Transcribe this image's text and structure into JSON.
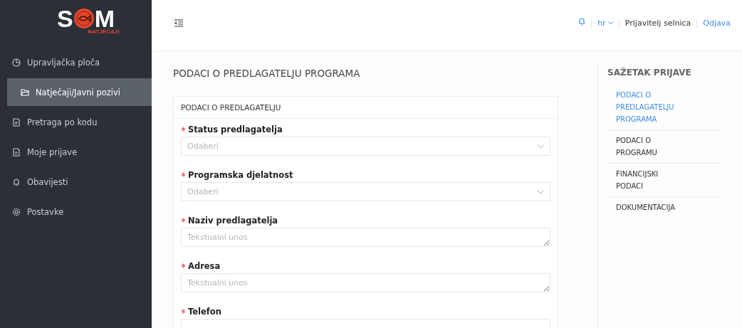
{
  "logo": {
    "left": "S",
    "right": "M",
    "subtitle": "NATJEČAJI"
  },
  "sidebar": {
    "items": [
      {
        "label": "Upravljačka ploča",
        "selected": false
      },
      {
        "label": "Natječaji/Javni pozivi",
        "selected": true
      },
      {
        "label": "Pretraga po kodu",
        "selected": false
      },
      {
        "label": "Moje prijave",
        "selected": false
      },
      {
        "label": "Obavijesti",
        "selected": false
      },
      {
        "label": "Postavke",
        "selected": false
      }
    ]
  },
  "header": {
    "language": "hr",
    "user": "Prijavitelj selnica",
    "logout": "Odjava"
  },
  "page_title": "PODACI O PREDLAGATELJU PROGRAMA",
  "card": {
    "title": "PODACI O PREDLAGATELJU",
    "fields": [
      {
        "label": "Status predlagatelja",
        "required": true,
        "kind": "select",
        "placeholder": "Odaberi"
      },
      {
        "label": "Programska djelatnost",
        "required": true,
        "kind": "select",
        "placeholder": "Odaberi"
      },
      {
        "label": "Naziv predlagatelja",
        "required": true,
        "kind": "textarea",
        "placeholder": "Tekstualni unos"
      },
      {
        "label": "Adresa",
        "required": true,
        "kind": "textarea",
        "placeholder": "Tekstualni unos"
      },
      {
        "label": "Telefon",
        "required": true,
        "kind": "text"
      }
    ]
  },
  "summary": {
    "title": "SAŽETAK PRIJAVE",
    "items": [
      {
        "label": "PODACI O PREDLAGATELJU PROGRAMA",
        "selected": true
      },
      {
        "label": "PODACI O PROGRAMU",
        "selected": false
      },
      {
        "label": "FINANCIJSKI PODACI",
        "selected": false
      },
      {
        "label": "DOKUMENTACIJA",
        "selected": false
      }
    ]
  }
}
